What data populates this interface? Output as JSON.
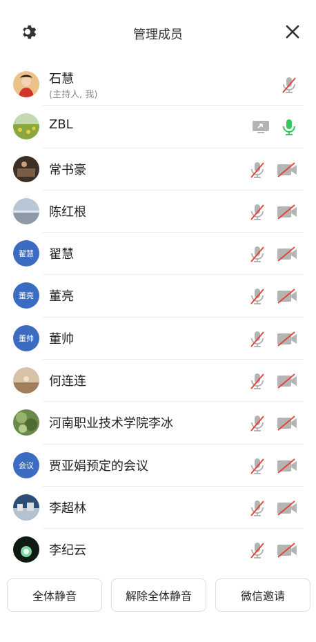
{
  "header": {
    "title": "管理成员",
    "icons": [
      "gear-icon",
      "close-icon"
    ]
  },
  "members": [
    {
      "name": "石慧",
      "sub": "(主持人, 我)",
      "avatar": "photo"
    },
    {
      "name": "ZBL",
      "avatar": "photo"
    },
    {
      "name": "常书豪",
      "avatar": "photo"
    },
    {
      "name": "陈红根",
      "avatar": "photo"
    },
    {
      "name": "翟慧",
      "avatar_text": "翟慧"
    },
    {
      "name": "董亮",
      "avatar_text": "董亮"
    },
    {
      "name": "董帅",
      "avatar_text": "董帅"
    },
    {
      "name": "何连连",
      "avatar": "photo"
    },
    {
      "name": "河南职业技术学院李冰",
      "avatar": "photo"
    },
    {
      "name": "贾亚娟预定的会议",
      "avatar_text": "会议"
    },
    {
      "name": "李超林",
      "avatar": "photo"
    },
    {
      "name": "李纪云",
      "avatar": "photo"
    }
  ],
  "footer": {
    "mute_all": "全体静音",
    "unmute_all": "解除全体静音",
    "wechat_invite": "微信邀请"
  },
  "colors": {
    "avatar_blue": "#3b6cc1",
    "mic_on": "#34c759",
    "mute_slash": "#e0453a",
    "icon_gray": "#b4b4b4"
  }
}
